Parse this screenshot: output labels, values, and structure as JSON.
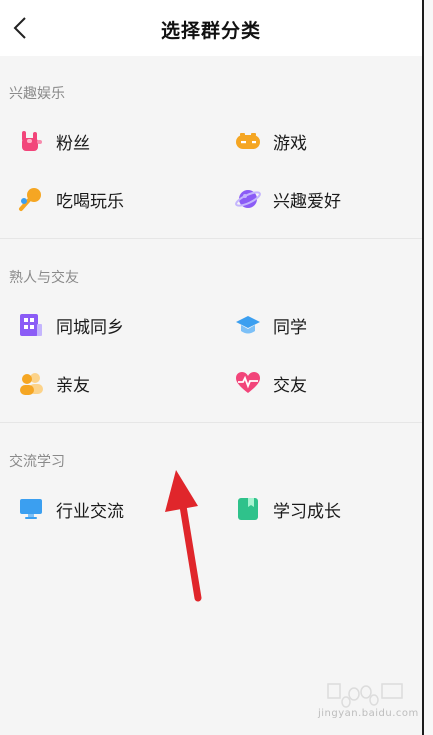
{
  "header": {
    "title": "选择群分类"
  },
  "sections": [
    {
      "title": "兴趣娱乐",
      "items": [
        {
          "label": "粉丝",
          "icon": "rock-hand-icon"
        },
        {
          "label": "游戏",
          "icon": "gamepad-icon"
        },
        {
          "label": "吃喝玩乐",
          "icon": "microphone-icon"
        },
        {
          "label": "兴趣爱好",
          "icon": "planet-icon"
        }
      ]
    },
    {
      "title": "熟人与交友",
      "items": [
        {
          "label": "同城同乡",
          "icon": "building-icon"
        },
        {
          "label": "同学",
          "icon": "graduation-cap-icon"
        },
        {
          "label": "亲友",
          "icon": "people-icon"
        },
        {
          "label": "交友",
          "icon": "heart-pulse-icon"
        }
      ]
    },
    {
      "title": "交流学习",
      "items": [
        {
          "label": "行业交流",
          "icon": "monitor-icon"
        },
        {
          "label": "学习成长",
          "icon": "book-icon"
        }
      ]
    }
  ],
  "watermark": {
    "text": "jingyan.baidu.com"
  },
  "colors": {
    "pink": "#f2457a",
    "orange": "#f5a623",
    "purple": "#8b5cf6",
    "blue": "#3b9ff0",
    "green": "#2fc28b"
  }
}
